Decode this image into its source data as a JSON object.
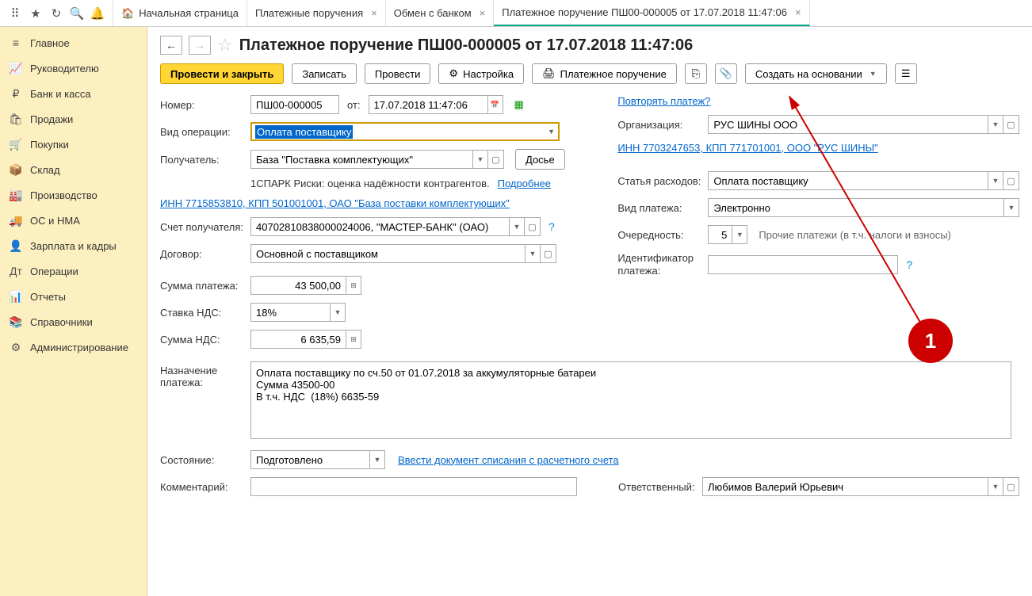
{
  "topbar": {
    "tabs": [
      {
        "label": "Начальная страница",
        "home": true
      },
      {
        "label": "Платежные поручения",
        "closable": true
      },
      {
        "label": "Обмен с банком",
        "closable": true
      },
      {
        "label": "Платежное поручение ПШ00-000005 от 17.07.2018 11:47:06",
        "closable": true,
        "active": true
      }
    ]
  },
  "sidebar": {
    "items": [
      "Главное",
      "Руководителю",
      "Банк и касса",
      "Продажи",
      "Покупки",
      "Склад",
      "Производство",
      "ОС и НМА",
      "Зарплата и кадры",
      "Операции",
      "Отчеты",
      "Справочники",
      "Администрирование"
    ]
  },
  "page": {
    "title": "Платежное поручение ПШ00-000005 от 17.07.2018 11:47:06",
    "toolbar": {
      "submit": "Провести и закрыть",
      "save": "Записать",
      "post": "Провести",
      "settings": "Настройка",
      "print": "Платежное поручение",
      "create_based": "Создать на основании"
    },
    "left": {
      "number_label": "Номер:",
      "number": "ПШ00-000005",
      "ot": "от:",
      "date": "17.07.2018 11:47:06",
      "repeat_link": "Повторять платеж?",
      "op_type_label": "Вид операции:",
      "op_type": "Оплата поставщику",
      "recipient_label": "Получатель:",
      "recipient": "База \"Поставка комплектующих\"",
      "dossier": "Досье",
      "spark": "1СПАРК Риски: оценка надёжности контрагентов.",
      "spark_more": "Подробнее",
      "inn_link": "ИНН 7715853810, КПП 501001001, ОАО \"База поставки комплектующих\"",
      "account_label": "Счет получателя:",
      "account": "40702810838000024006, \"МАСТЕР-БАНК\" (ОАО)",
      "contract_label": "Договор:",
      "contract": "Основной с поставщиком",
      "sum_label": "Сумма платежа:",
      "sum": "43 500,00",
      "vat_rate_label": "Ставка НДС:",
      "vat_rate": "18%",
      "vat_sum_label": "Сумма НДС:",
      "vat_sum": "6 635,59",
      "purpose_label": "Назначение платежа:",
      "purpose": "Оплата поставщику по сч.50 от 01.07.2018 за аккумуляторные батареи\nСумма 43500-00\nВ т.ч. НДС  (18%) 6635-59",
      "status_label": "Состояние:",
      "status": "Подготовлено",
      "enter_doc": "Ввести документ списания с расчетного счета",
      "comment_label": "Комментарий:"
    },
    "right": {
      "org_label": "Организация:",
      "org": "РУС ШИНЫ ООО",
      "org_link": "ИНН 7703247653, КПП 771701001, ООО \"РУС ШИНЫ\"",
      "expense_label": "Статья расходов:",
      "expense": "Оплата поставщику",
      "payment_type_label": "Вид платежа:",
      "payment_type": "Электронно",
      "order_label": "Очередность:",
      "order": "5",
      "order_desc": "Прочие платежи (в т.ч. налоги и взносы)",
      "id_label": "Идентификатор платежа:",
      "responsible_label": "Ответственный:",
      "responsible": "Любимов Валерий Юрьевич"
    },
    "annotation": "1"
  }
}
